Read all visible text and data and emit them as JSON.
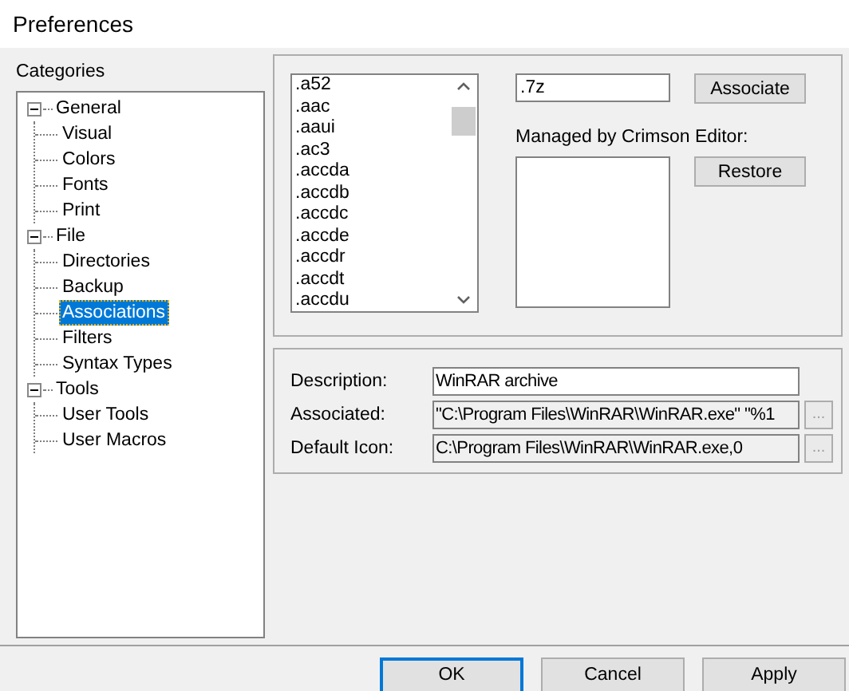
{
  "window": {
    "title": "Preferences"
  },
  "categories": {
    "label": "Categories",
    "items": [
      {
        "label": "General",
        "expanded": true,
        "selected": false,
        "children": [
          {
            "label": "Visual",
            "selected": false
          },
          {
            "label": "Colors",
            "selected": false
          },
          {
            "label": "Fonts",
            "selected": false
          },
          {
            "label": "Print",
            "selected": false
          }
        ]
      },
      {
        "label": "File",
        "expanded": true,
        "selected": false,
        "children": [
          {
            "label": "Directories",
            "selected": false
          },
          {
            "label": "Backup",
            "selected": false
          },
          {
            "label": "Associations",
            "selected": true
          },
          {
            "label": "Filters",
            "selected": false
          },
          {
            "label": "Syntax Types",
            "selected": false
          }
        ]
      },
      {
        "label": "Tools",
        "expanded": true,
        "selected": false,
        "children": [
          {
            "label": "User Tools",
            "selected": false
          },
          {
            "label": "User Macros",
            "selected": false
          }
        ]
      }
    ]
  },
  "extensions": [
    ".a52",
    ".aac",
    ".aaui",
    ".ac3",
    ".accda",
    ".accdb",
    ".accdc",
    ".accde",
    ".accdr",
    ".accdt",
    ".accdu"
  ],
  "extension_field": {
    "value": ".7z"
  },
  "associate_button": "Associate",
  "managed_label": "Managed by Crimson Editor:",
  "restore_button": "Restore",
  "details": [
    {
      "label": "Description:",
      "value": "WinRAR archive",
      "disabled": false
    },
    {
      "label": "Associated:",
      "value": "\"C:\\Program Files\\WinRAR\\WinRAR.exe\" \"%1",
      "disabled": true,
      "browse": "..."
    },
    {
      "label": "Default Icon:",
      "value": "C:\\Program Files\\WinRAR\\WinRAR.exe,0",
      "disabled": true,
      "browse": "..."
    }
  ],
  "buttons": [
    {
      "label": "OK",
      "default": true
    },
    {
      "label": "Cancel",
      "default": false
    },
    {
      "label": "Apply",
      "default": false
    }
  ]
}
